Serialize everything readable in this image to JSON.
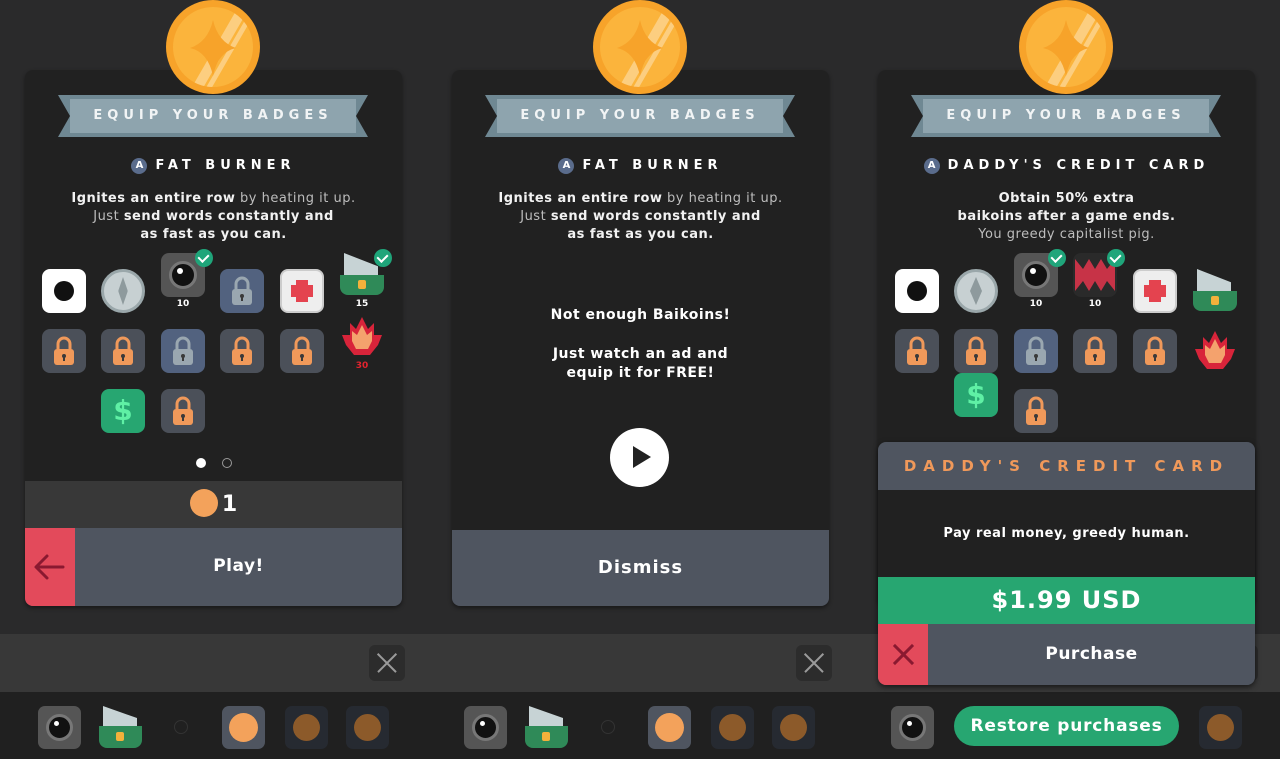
{
  "screens": [
    {
      "id": "badge-select",
      "ribbon": "EQUIP YOUR BADGES",
      "badge_rank": "A",
      "badge_name": "FAT BURNER",
      "description": [
        [
          {
            "t": "Ignites an entire row",
            "b": true
          },
          {
            "t": " by heating it up.",
            "b": false
          }
        ],
        [
          {
            "t": "Just ",
            "b": false
          },
          {
            "t": "send words constantly and",
            "b": true
          }
        ],
        [
          {
            "t": "as fast as you can.",
            "b": true
          }
        ]
      ],
      "coins": "1",
      "action_label": "Play!",
      "page_dots": {
        "total": 2,
        "active": 1
      },
      "grid_labels": {
        "eye": "10",
        "shredder": "15",
        "fire": "30"
      }
    },
    {
      "id": "watch-ad",
      "ribbon": "EQUIP YOUR BADGES",
      "badge_rank": "A",
      "badge_name": "FAT BURNER",
      "description": [
        [
          {
            "t": "Ignites an entire row",
            "b": true
          },
          {
            "t": " by heating it up.",
            "b": false
          }
        ],
        [
          {
            "t": "Just ",
            "b": false
          },
          {
            "t": "send words constantly and",
            "b": true
          }
        ],
        [
          {
            "t": "as fast as you can.",
            "b": true
          }
        ]
      ],
      "message_line1": "Not enough Baikoins!",
      "message_line2": "Just watch an ad and",
      "message_line3": "equip it for FREE!",
      "dismiss_label": "Dismiss"
    },
    {
      "id": "purchase",
      "ribbon": "EQUIP YOUR BADGES",
      "badge_rank": "A",
      "badge_name": "DADDY'S CREDIT CARD",
      "description": [
        [
          {
            "t": "Obtain 50% extra",
            "b": true
          }
        ],
        [
          {
            "t": "baikoins after a game ends.",
            "b": true
          }
        ],
        [
          {
            "t": "You greedy capitalist pig.",
            "b": false
          }
        ]
      ],
      "grid_labels": {
        "eye": "10",
        "monster": "10"
      },
      "modal": {
        "title": "DADDY'S CREDIT CARD",
        "body": "Pay real money, greedy human.",
        "price": "$1.99 USD",
        "purchase_label": "Purchase"
      },
      "restore_label": "Restore purchases"
    }
  ],
  "colors": {
    "background": "#2a2a2b",
    "panel": "#212121",
    "action_bar": "#4f5560",
    "back_red": "#e34a5b",
    "green": "#27a671",
    "orange_accent": "#f0995a",
    "coin_orange": "#f7a32a",
    "ribbon": "#8ea4ae"
  }
}
